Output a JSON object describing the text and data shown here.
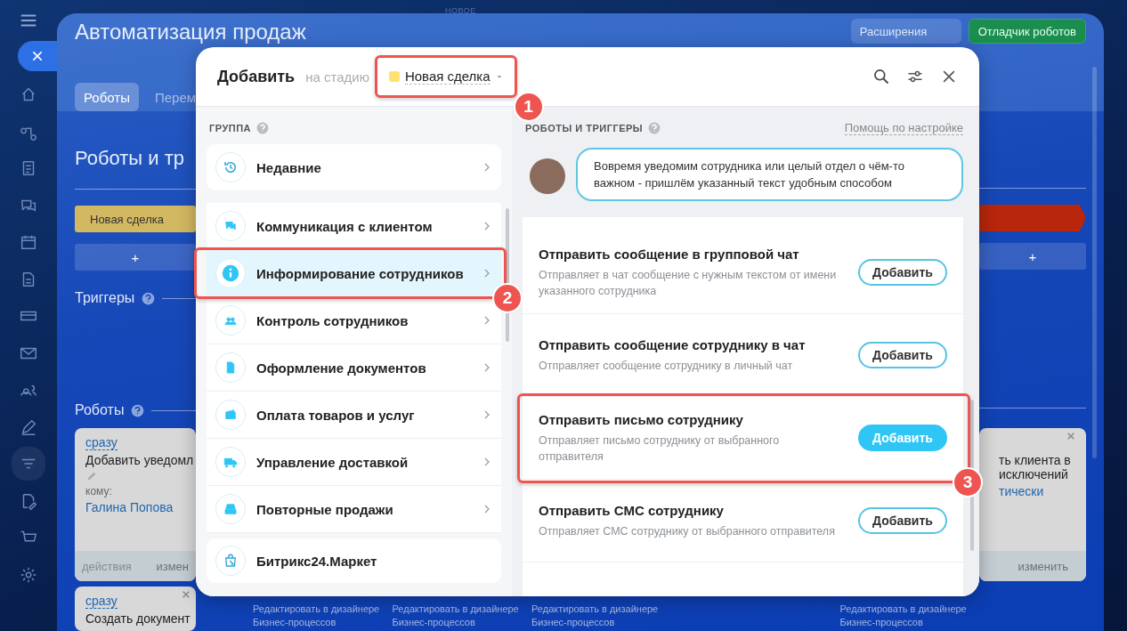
{
  "top_label": "НОВОЕ",
  "page": {
    "title": "Автоматизация продаж",
    "tabs": [
      {
        "label": "Роботы",
        "selected": true
      },
      {
        "label": "Перем",
        "selected": false
      }
    ],
    "buttons": [
      {
        "label": "Расширения",
        "kind": "faded"
      },
      {
        "label": "Отладчик роботов",
        "kind": "primary"
      }
    ],
    "section_title": "Роботы и тр",
    "stages": [
      {
        "label": "Новая сделка",
        "color": "#d2b861"
      },
      {
        "color": "#b8260c"
      }
    ],
    "add_buttons": [
      "+",
      "+"
    ],
    "triggers_title": "Триггеры",
    "robots_title": "Роботы",
    "left_cards": [
      {
        "delay": "сразу",
        "title": "Добавить уведомл",
        "to_label": "кому:",
        "to_value": "Галина Попова",
        "footer_left": "действия",
        "footer_right": "измен"
      },
      {
        "delay": "сразу",
        "title": "Создать документ"
      }
    ],
    "right_card": {
      "title": "ть клиента в исключений",
      "link": "тически",
      "footer_right": "изменить"
    },
    "designer_links": [
      "Редактировать в дизайнере Бизнес-процессов",
      "Редактировать в дизайнере Бизнес-процессов",
      "Редактировать в дизайнере Бизнес-процессов",
      "Редактировать в дизайнере Бизнес-процессов"
    ]
  },
  "dialog": {
    "title": "Добавить",
    "stage_label": "на стадию",
    "stage": {
      "label": "Новая сделка",
      "color": "#ffe16f",
      "callout": "1"
    },
    "groups_heading": "ГРУППА",
    "recent": "Недавние",
    "groups": [
      {
        "label": "Коммуникация с клиентом",
        "selected": false
      },
      {
        "label": "Информирование сотрудников",
        "selected": true,
        "callout": "2"
      },
      {
        "label": "Контроль сотрудников",
        "selected": false
      },
      {
        "label": "Оформление документов",
        "selected": false
      },
      {
        "label": "Оплата товаров и услуг",
        "selected": false
      },
      {
        "label": "Управление доставкой",
        "selected": false
      },
      {
        "label": "Повторные продажи",
        "selected": false
      }
    ],
    "market": "Битрикс24.Маркет",
    "robots_heading": "РОБОТЫ И ТРИГГЕРЫ",
    "help_link": "Помощь по настройке",
    "hint": "Вовремя уведомим сотрудника или целый отдел о чём-то важном - пришлём указанный текст удобным способом",
    "robots": [
      {
        "title": "Отправить сообщение в групповой чат",
        "description": "Отправляет в чат сообщение с нужным текстом от имени указанного сотрудника",
        "button": "Добавить",
        "highlighted": false
      },
      {
        "title": "Отправить сообщение сотруднику в чат",
        "description": "Отправляет сообщение сотруднику в личный чат",
        "button": "Добавить",
        "highlighted": false
      },
      {
        "title": "Отправить письмо сотруднику",
        "description": "Отправляет письмо сотруднику от выбранного отправителя",
        "button": "Добавить",
        "highlighted": true,
        "callout": "3"
      },
      {
        "title": "Отправить СМС сотруднику",
        "description": "Отправляет СМС сотруднику от выбранного отправителя",
        "button": "Добавить",
        "highlighted": false
      }
    ]
  }
}
